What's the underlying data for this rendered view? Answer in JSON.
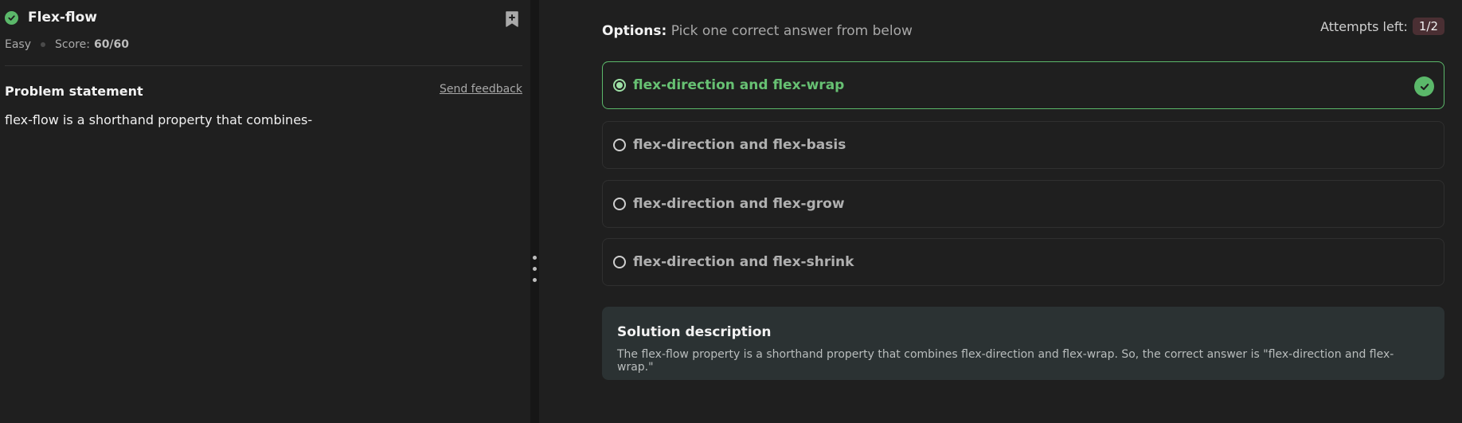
{
  "question": {
    "title": "Flex-flow",
    "difficulty": "Easy",
    "score_label": "Score:",
    "score_value": "60/60",
    "problem_statement_heading": "Problem statement",
    "send_feedback": "Send feedback",
    "problem_text": "flex-flow is a shorthand property that combines-"
  },
  "options": {
    "heading": "Options:",
    "subheading": "Pick one correct answer from below",
    "attempts_label": "Attempts left:",
    "attempts_value": "1/2",
    "items": [
      {
        "label": "flex-direction and flex-wrap",
        "selected": true,
        "correct": true
      },
      {
        "label": "flex-direction and flex-basis",
        "selected": false
      },
      {
        "label": "flex-direction and flex-grow",
        "selected": false
      },
      {
        "label": "flex-direction and flex-shrink",
        "selected": false
      }
    ]
  },
  "solution": {
    "heading": "Solution description",
    "text": "The flex-flow property is a shorthand property that combines flex-direction and flex-wrap. So, the correct answer is \"flex-direction and flex-wrap.\""
  },
  "colors": {
    "accent_green": "#5bb86a",
    "background": "#1f1f1f",
    "solution_bg": "#2b3233",
    "attempts_badge_bg": "#4a2f33"
  }
}
